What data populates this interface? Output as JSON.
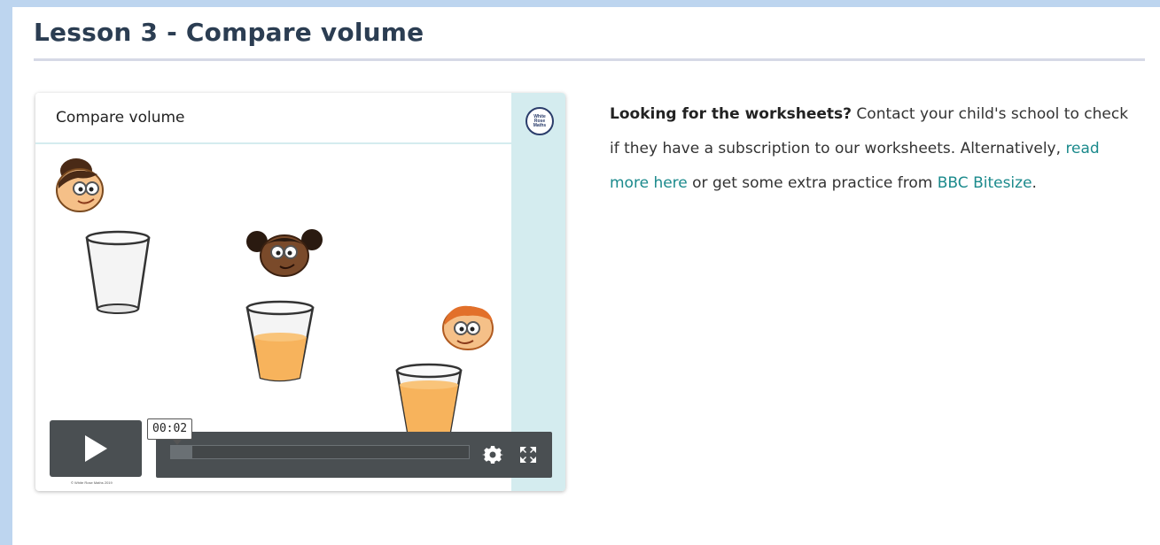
{
  "page": {
    "title": "Lesson 3 - Compare volume"
  },
  "video": {
    "heading": "Compare volume",
    "logo_text": "White Rose Maths",
    "current_time": "00:02",
    "progress": 0.07,
    "copyright": "© White Rose Maths 2019",
    "icons": {
      "play": "play-icon",
      "settings": "gear-icon",
      "fullscreen": "fullscreen-icon"
    }
  },
  "info": {
    "lead_bold": "Looking for the worksheets?",
    "lead_text": " Contact your child's school to check if they have a subscription to our worksheets. Alternatively, ",
    "link_read_more": "read more here",
    "middle_text": " or get some extra practice from ",
    "link_bbc": "BBC Bitesize",
    "end_text": "."
  },
  "colors": {
    "background": "#bdd5ef",
    "title": "#2b3d52",
    "link": "#1b8a8c",
    "strip": "#d4ecef",
    "player": "#4a4f52",
    "juice": "#f7b35c"
  }
}
